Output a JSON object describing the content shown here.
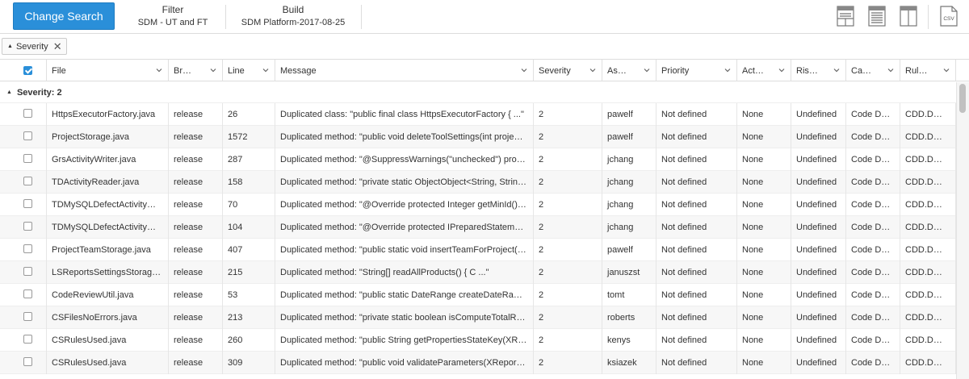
{
  "toolbar": {
    "change_search_label": "Change Search",
    "filter_title": "Filter",
    "filter_value": "SDM - UT and FT",
    "build_title": "Build",
    "build_value": "SDM Platform-2017-08-25",
    "csv_label": "CSV"
  },
  "filter_chip": {
    "label": "Severity"
  },
  "grid": {
    "columns": [
      "File",
      "Br…",
      "Line",
      "Message",
      "Severity",
      "As…",
      "Priority",
      "Act…",
      "Ris…",
      "Ca…",
      "Rul…"
    ],
    "group_label": "Severity: 2",
    "rows": [
      {
        "file": "HttpsExecutorFactory.java",
        "branch": "release",
        "line": "26",
        "message": "Duplicated class: \"public final class HttpsExecutorFactory { ...\"",
        "severity": "2",
        "assignee": "pawelf",
        "priority": "Not defined",
        "action": "None",
        "risk": "Undefined",
        "category": "Code D…",
        "rule": "CDD.D…"
      },
      {
        "file": "ProjectStorage.java",
        "branch": "release",
        "line": "1572",
        "message": "Duplicated method: \"public void deleteToolSettings(int proje…",
        "severity": "2",
        "assignee": "pawelf",
        "priority": "Not defined",
        "action": "None",
        "risk": "Undefined",
        "category": "Code D…",
        "rule": "CDD.D…"
      },
      {
        "file": "GrsActivityWriter.java",
        "branch": "release",
        "line": "287",
        "message": "Duplicated method: \"@SuppressWarnings(\"unchecked\") pro…",
        "severity": "2",
        "assignee": "jchang",
        "priority": "Not defined",
        "action": "None",
        "risk": "Undefined",
        "category": "Code D…",
        "rule": "CDD.D…"
      },
      {
        "file": "TDActivityReader.java",
        "branch": "release",
        "line": "158",
        "message": "Duplicated method: \"private static ObjectObject<String, Strin…",
        "severity": "2",
        "assignee": "jchang",
        "priority": "Not defined",
        "action": "None",
        "risk": "Undefined",
        "category": "Code D…",
        "rule": "CDD.D…"
      },
      {
        "file": "TDMySQLDefectActivity…",
        "branch": "release",
        "line": "70",
        "message": "Duplicated method: \"@Override protected Integer getMinId()…",
        "severity": "2",
        "assignee": "jchang",
        "priority": "Not defined",
        "action": "None",
        "risk": "Undefined",
        "category": "Code D…",
        "rule": "CDD.D…"
      },
      {
        "file": "TDMySQLDefectActivity…",
        "branch": "release",
        "line": "104",
        "message": "Duplicated method: \"@Override protected IPreparedStatem…",
        "severity": "2",
        "assignee": "jchang",
        "priority": "Not defined",
        "action": "None",
        "risk": "Undefined",
        "category": "Code D…",
        "rule": "CDD.D…"
      },
      {
        "file": "ProjectTeamStorage.java",
        "branch": "release",
        "line": "407",
        "message": "Duplicated method: \"public static void insertTeamForProject(…",
        "severity": "2",
        "assignee": "pawelf",
        "priority": "Not defined",
        "action": "None",
        "risk": "Undefined",
        "category": "Code D…",
        "rule": "CDD.D…"
      },
      {
        "file": "LSReportsSettingsStorag…",
        "branch": "release",
        "line": "215",
        "message": "Duplicated method: \"String[] readAllProducts() { C ...\"",
        "severity": "2",
        "assignee": "januszst",
        "priority": "Not defined",
        "action": "None",
        "risk": "Undefined",
        "category": "Code D…",
        "rule": "CDD.D…"
      },
      {
        "file": "CodeReviewUtil.java",
        "branch": "release",
        "line": "53",
        "message": "Duplicated method: \"public static DateRange createDateRa…",
        "severity": "2",
        "assignee": "tomt",
        "priority": "Not defined",
        "action": "None",
        "risk": "Undefined",
        "category": "Code D…",
        "rule": "CDD.D…"
      },
      {
        "file": "CSFilesNoErrors.java",
        "branch": "release",
        "line": "213",
        "message": "Duplicated method: \"private static boolean isComputeTotalR…",
        "severity": "2",
        "assignee": "roberts",
        "priority": "Not defined",
        "action": "None",
        "risk": "Undefined",
        "category": "Code D…",
        "rule": "CDD.D…"
      },
      {
        "file": "CSRulesUsed.java",
        "branch": "release",
        "line": "260",
        "message": "Duplicated method: \"public String getPropertiesStateKey(XR…",
        "severity": "2",
        "assignee": "kenys",
        "priority": "Not defined",
        "action": "None",
        "risk": "Undefined",
        "category": "Code D…",
        "rule": "CDD.D…"
      },
      {
        "file": "CSRulesUsed.java",
        "branch": "release",
        "line": "309",
        "message": "Duplicated method: \"public void validateParameters(XRepor…",
        "severity": "2",
        "assignee": "ksiazek",
        "priority": "Not defined",
        "action": "None",
        "risk": "Undefined",
        "category": "Code D…",
        "rule": "CDD.D…"
      }
    ]
  },
  "colors": {
    "accent": "#2a8fd9",
    "row_alt": "#f7f7f7"
  },
  "icons": [
    "layout-top-icon",
    "layout-list-icon",
    "layout-split-icon",
    "csv-export-icon",
    "close-icon",
    "chevron-down-icon",
    "collapse-triangle-icon"
  ]
}
